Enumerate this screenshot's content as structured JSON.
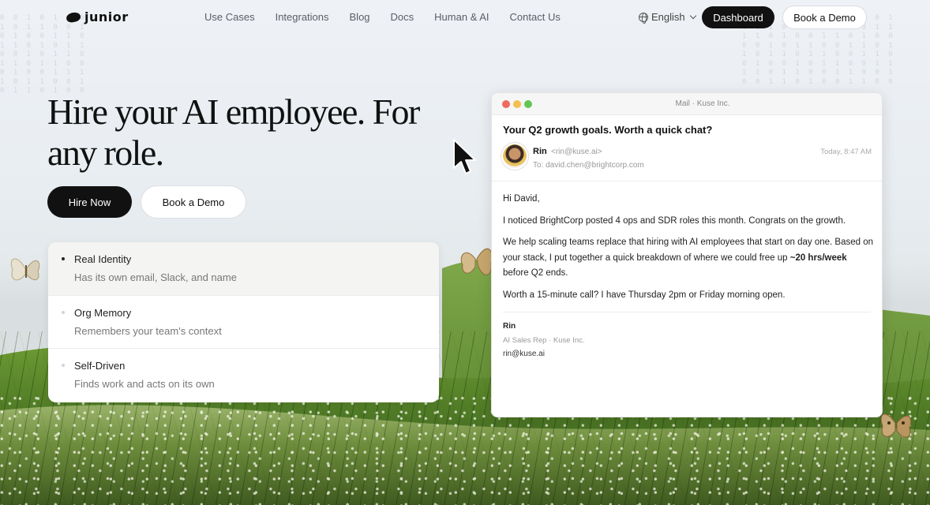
{
  "nav": {
    "brand": "junior",
    "links": [
      "Use Cases",
      "Integrations",
      "Blog",
      "Docs",
      "Human & AI",
      "Contact Us"
    ],
    "language": "English",
    "dashboard_label": "Dashboard",
    "demo_label": "Book a Demo"
  },
  "hero": {
    "title": "Hire your AI employee. For any role.",
    "hire_label": "Hire Now",
    "demo_label": "Book a Demo"
  },
  "features": [
    {
      "title": "Real Identity",
      "desc": "Has its own email, Slack, and name"
    },
    {
      "title": "Org Memory",
      "desc": "Remembers your team's context"
    },
    {
      "title": "Self-Driven",
      "desc": "Finds work and acts on its own"
    }
  ],
  "mail": {
    "window_title": "Mail · Kuse Inc.",
    "subject": "Your Q2 growth goals. Worth a quick chat?",
    "sender_name": "Rin",
    "sender_email": "<rin@kuse.ai>",
    "to": "To: david.chen@brightcorp.com",
    "time": "Today, 8:47 AM",
    "greeting": "Hi David,",
    "p1": "I noticed BrightCorp posted 4 ops and SDR roles this month. Congrats on the growth.",
    "p2_before": "We help scaling teams replace that hiring with AI employees that start on day one. Based on your stack, I put together a quick breakdown of where we could free up ",
    "p2_bold": "~20 hrs/week",
    "p2_after": " before Q2 ends.",
    "p3": "Worth a 15-minute call? I have Thursday 2pm or Friday morning open.",
    "sig_name": "Rin",
    "sig_role": "AI Sales Rep · Kuse Inc.",
    "sig_email": "rin@kuse.ai"
  },
  "colors": {
    "dark": "#111111",
    "grass": "#5b8a2c"
  }
}
